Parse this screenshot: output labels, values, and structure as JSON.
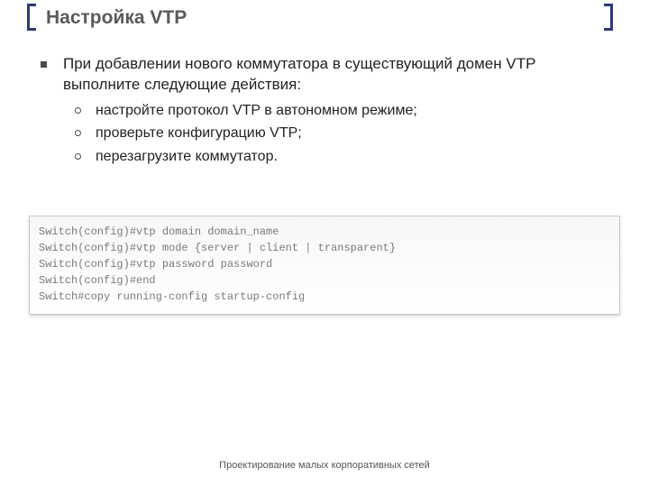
{
  "header": {
    "title": "Настройка VTP"
  },
  "main_bullet": "При добавлении нового коммутатора в существующий домен VTP выполните следующие действия:",
  "sub_bullets": [
    "настройте протокол VTP в автономном режиме;",
    "проверьте конфигурацию VTP;",
    "перезагрузите коммутатор."
  ],
  "code_lines": [
    "Switch(config)#vtp domain domain_name",
    "Switch(config)#vtp mode {server | client | transparent}",
    "Switch(config)#vtp password password",
    "Switch(config)#end",
    "Switch#copy running-config startup-config"
  ],
  "footer": "Проектирование малых корпоративных сетей"
}
